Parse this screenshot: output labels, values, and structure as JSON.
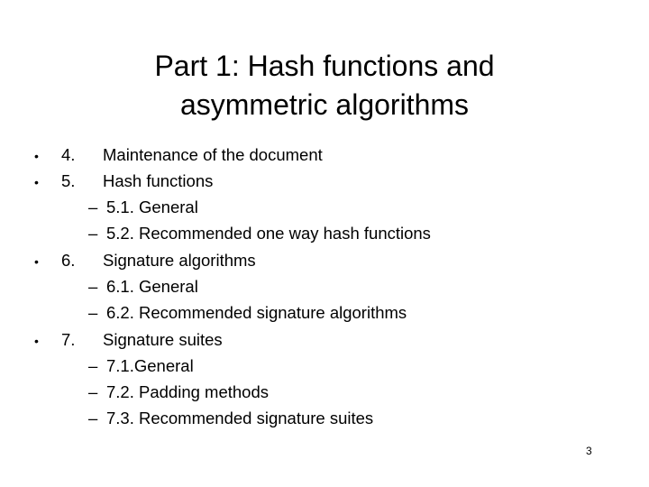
{
  "slide": {
    "title_lines": [
      "Part 1: Hash functions and",
      "asymmetric algorithms"
    ],
    "items": [
      {
        "level": 1,
        "marker": "•",
        "number": "4.",
        "text": "Maintenance of the document"
      },
      {
        "level": 1,
        "marker": "•",
        "number": "5.",
        "text": "Hash functions"
      },
      {
        "level": 2,
        "marker": "–",
        "text": "5.1. General"
      },
      {
        "level": 2,
        "marker": "–",
        "text": "5.2. Recommended one way hash functions"
      },
      {
        "level": 1,
        "marker": "•",
        "number": "6.",
        "text": "Signature algorithms"
      },
      {
        "level": 2,
        "marker": "–",
        "text": "6.1. General"
      },
      {
        "level": 2,
        "marker": "–",
        "text": "6.2. Recommended signature algorithms"
      },
      {
        "level": 1,
        "marker": "•",
        "number": "7.",
        "text": "Signature suites"
      },
      {
        "level": 2,
        "marker": "–",
        "text": "7.1.General"
      },
      {
        "level": 2,
        "marker": "–",
        "text": "7.2. Padding methods"
      },
      {
        "level": 2,
        "marker": "–",
        "text": "7.3. Recommended signature suites"
      }
    ],
    "page_number": "3"
  }
}
